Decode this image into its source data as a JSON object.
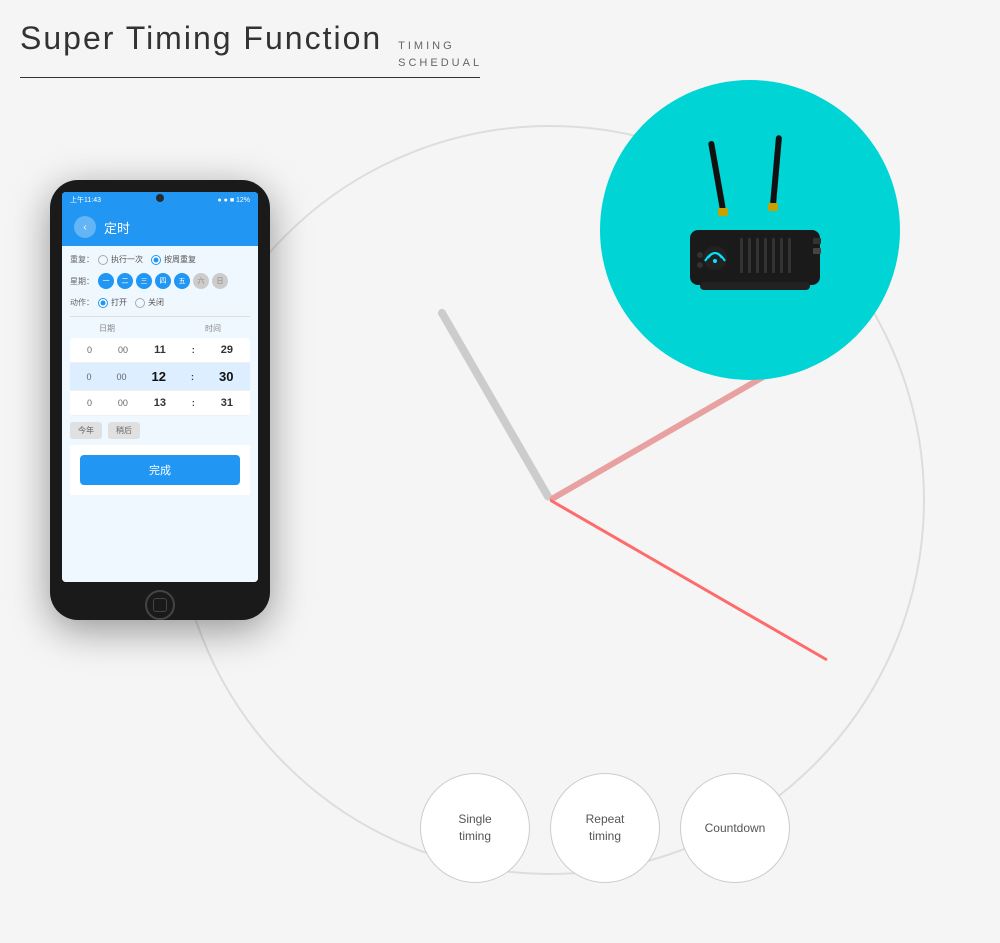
{
  "header": {
    "title": "Super Timing Function",
    "subtitle_line1": "TIMING",
    "subtitle_line2": "SCHEDUAL"
  },
  "phone": {
    "status_bar": {
      "time": "上午11:43",
      "icons": "● ● ■ 12%"
    },
    "nav_title": "定时",
    "back_icon": "‹",
    "repeat_label": "重复：",
    "repeat_options": [
      {
        "label": "执行一次",
        "selected": false
      },
      {
        "label": "按周重复",
        "selected": true
      }
    ],
    "weekday_label": "星期：",
    "days": [
      {
        "label": "一",
        "active": true
      },
      {
        "label": "二",
        "active": true
      },
      {
        "label": "三",
        "active": true
      },
      {
        "label": "四",
        "active": true
      },
      {
        "label": "五",
        "active": true
      },
      {
        "label": "六",
        "active": false
      },
      {
        "label": "日",
        "active": false
      }
    ],
    "action_label": "动作：",
    "action_options": [
      {
        "label": "打开",
        "selected": true
      },
      {
        "label": "关闭",
        "selected": false
      }
    ],
    "col_date": "日期",
    "col_time": "时间",
    "time_rows": [
      {
        "date": "0",
        "hour": "00",
        "h": "11",
        "m": "29",
        "active": false
      },
      {
        "date": "0",
        "hour": "00",
        "h": "12",
        "m": "30",
        "active": true
      },
      {
        "date": "0",
        "hour": "00",
        "h": "13",
        "m": "31",
        "active": false
      }
    ],
    "btn1": "今年",
    "btn2": "稍后",
    "btn_complete": "完成"
  },
  "features": [
    {
      "line1": "Single",
      "line2": "timing"
    },
    {
      "line1": "Repeat",
      "line2": "timing"
    },
    {
      "line1": "Countdown",
      "line2": ""
    }
  ]
}
